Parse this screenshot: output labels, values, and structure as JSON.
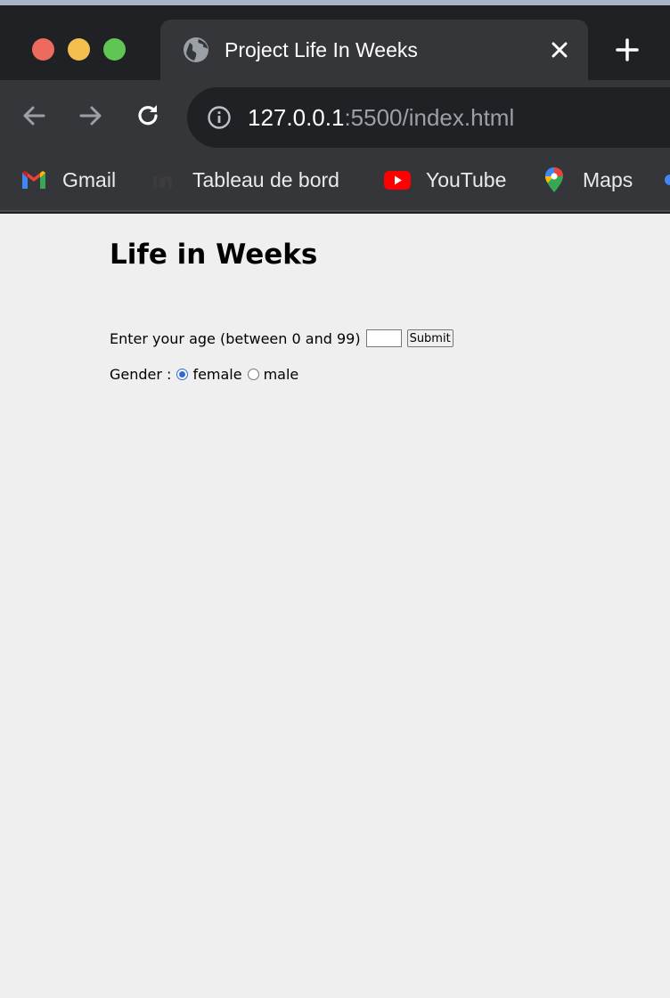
{
  "browser": {
    "tab_title": "Project Life In Weeks",
    "url_host": "127.0.0.1",
    "url_rest": ":5500/index.html",
    "bookmarks": [
      {
        "label": "Gmail",
        "icon": "gmail-icon"
      },
      {
        "label": "Tableau de bord",
        "icon": "tableau-icon"
      },
      {
        "label": "YouTube",
        "icon": "youtube-icon"
      },
      {
        "label": "Maps",
        "icon": "maps-icon"
      }
    ],
    "colors": {
      "titlebar": "#202124",
      "toolbar": "#35363a",
      "close_red": "#ed6a5e",
      "minimize_yellow": "#f5bf4f",
      "zoom_green": "#61c554"
    }
  },
  "page": {
    "title": "Life in Weeks",
    "age_label": "Enter your age (between 0 and 99)",
    "age_value": "",
    "submit_label": "Submit",
    "gender_label": "Gender :",
    "gender_options": [
      {
        "label": "female",
        "checked": true
      },
      {
        "label": "male",
        "checked": false
      }
    ],
    "colors": {
      "background": "#efefef",
      "radio_accent": "#2f6bd8"
    }
  }
}
